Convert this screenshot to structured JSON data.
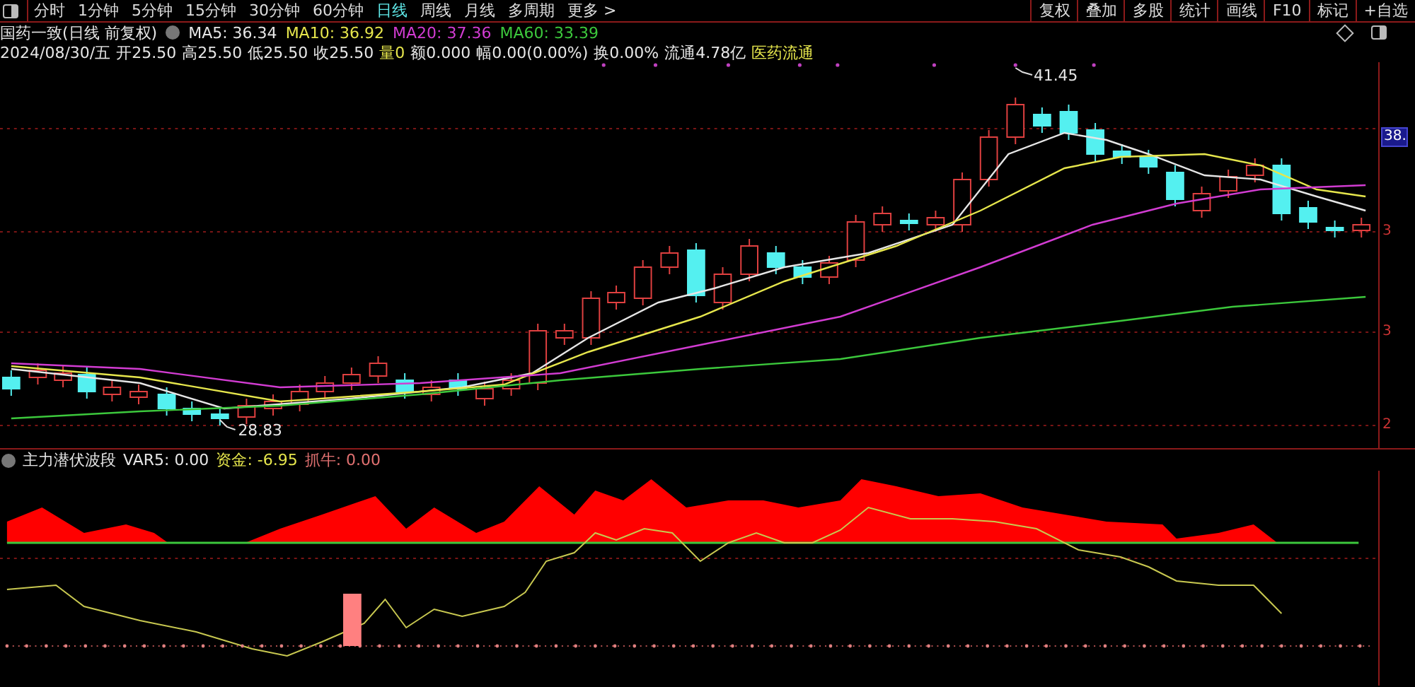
{
  "toolbar": {
    "periods": [
      {
        "label": "分时",
        "selected": false
      },
      {
        "label": "1分钟",
        "selected": false
      },
      {
        "label": "5分钟",
        "selected": false
      },
      {
        "label": "15分钟",
        "selected": false
      },
      {
        "label": "30分钟",
        "selected": false
      },
      {
        "label": "60分钟",
        "selected": false
      },
      {
        "label": "日线",
        "selected": true
      },
      {
        "label": "周线",
        "selected": false
      },
      {
        "label": "月线",
        "selected": false
      },
      {
        "label": "多周期",
        "selected": false
      }
    ],
    "more": {
      "label": "更多",
      "caret": ">"
    },
    "buttons": [
      "复权",
      "叠加",
      "多股",
      "统计",
      "画线",
      "F10",
      "标记",
      "+自选"
    ]
  },
  "header": {
    "title": "国药一致(日线 前复权)",
    "ma": [
      {
        "label": "MA5: 36.34",
        "color": "#e6e6e6"
      },
      {
        "label": "MA10: 36.92",
        "color": "#e6e64c"
      },
      {
        "label": "MA20: 37.36",
        "color": "#d23cd2"
      },
      {
        "label": "MA60: 33.39",
        "color": "#3cc83c"
      }
    ]
  },
  "quote": [
    {
      "text": "2024/08/30/五",
      "color": "#e6e6e6"
    },
    {
      "text": "开25.50",
      "color": "#e6e6e6"
    },
    {
      "text": "高25.50",
      "color": "#e6e6e6"
    },
    {
      "text": "低25.50",
      "color": "#e6e6e6"
    },
    {
      "text": "收25.50",
      "color": "#e6e6e6"
    },
    {
      "text": "量0",
      "color": "#e6e64c"
    },
    {
      "text": "额0.000",
      "color": "#e6e6e6"
    },
    {
      "text": "幅0.00(0.00%)",
      "color": "#e6e6e6"
    },
    {
      "text": "换0.00%",
      "color": "#e6e6e6"
    },
    {
      "text": "流通4.78亿",
      "color": "#e6e6e6"
    },
    {
      "text": "医药流通",
      "color": "#e6e64c"
    }
  ],
  "main_chart": {
    "high_label": "41.45",
    "low_label": "28.83",
    "axis_labels": [
      {
        "text": "38.",
        "highlighted": true
      },
      {
        "text": "3",
        "highlighted": false
      },
      {
        "text": "3",
        "highlighted": false
      },
      {
        "text": "2",
        "highlighted": false
      }
    ]
  },
  "indicator": {
    "name": "主力潜伏波段",
    "values": [
      {
        "label": "VAR5: 0.00",
        "color": "#e6e6e6"
      },
      {
        "label": "资金: -6.95",
        "color": "#e6e64c"
      },
      {
        "label": "抓牛: 0.00",
        "color": "#e07070"
      }
    ]
  }
}
